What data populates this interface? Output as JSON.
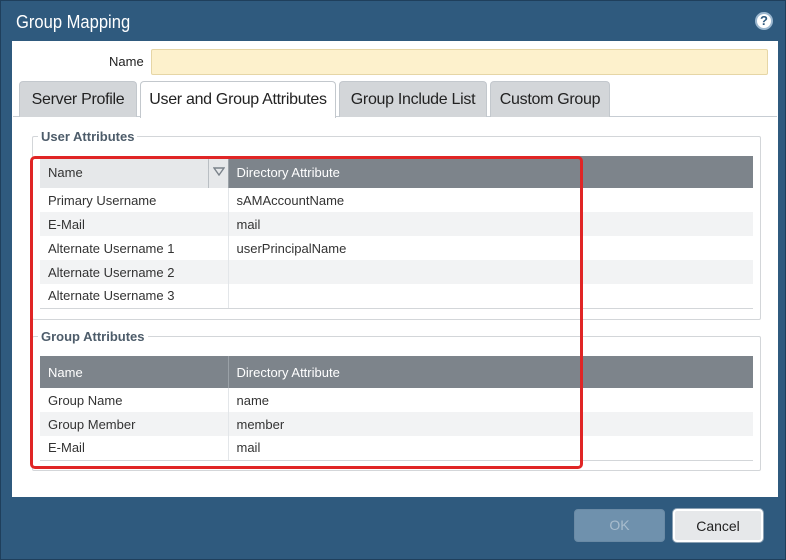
{
  "window": {
    "title": "Group Mapping",
    "help_icon": "help-icon",
    "help_glyph": "?"
  },
  "form": {
    "name_label": "Name",
    "name_value": "",
    "name_placeholder": ""
  },
  "tabs": [
    {
      "label": "Server Profile",
      "active": false
    },
    {
      "label": "User and Group Attributes",
      "active": true
    },
    {
      "label": "Group Include List",
      "active": false
    },
    {
      "label": "Custom Group",
      "active": false
    }
  ],
  "user_attributes": {
    "legend": "User Attributes",
    "columns": [
      "Name",
      "Directory Attribute"
    ],
    "sort_icon": "sort-desc-icon",
    "rows": [
      {
        "name": "Primary Username",
        "attribute": "sAMAccountName"
      },
      {
        "name": "E-Mail",
        "attribute": "mail"
      },
      {
        "name": "Alternate Username 1",
        "attribute": "userPrincipalName"
      },
      {
        "name": "Alternate Username 2",
        "attribute": ""
      },
      {
        "name": "Alternate Username 3",
        "attribute": ""
      }
    ]
  },
  "group_attributes": {
    "legend": "Group Attributes",
    "columns": [
      "Name",
      "Directory Attribute"
    ],
    "rows": [
      {
        "name": "Group Name",
        "attribute": "name"
      },
      {
        "name": "Group Member",
        "attribute": "member"
      },
      {
        "name": "E-Mail",
        "attribute": "mail"
      }
    ]
  },
  "buttons": {
    "ok": "OK",
    "ok_enabled": false,
    "cancel": "Cancel"
  },
  "colors": {
    "titlebar": "#2f5a7e",
    "header": "#7d848b",
    "name_field": "#fdf1cc",
    "highlight": "#e02525"
  }
}
